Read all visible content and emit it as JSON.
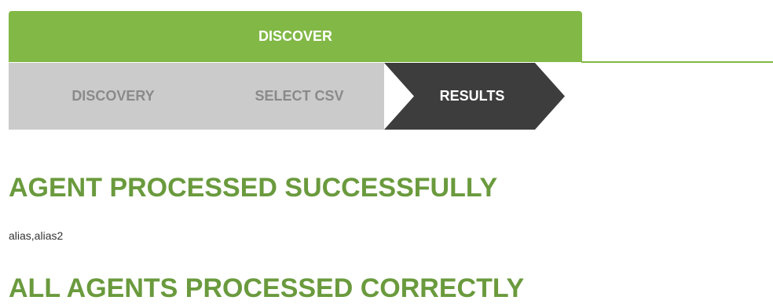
{
  "tabs": {
    "discover_label": "DISCOVER"
  },
  "wizard": {
    "steps": [
      {
        "label": "DISCOVERY",
        "state": "done"
      },
      {
        "label": "SELECT CSV",
        "state": "done"
      },
      {
        "label": "RESULTS",
        "state": "active"
      }
    ]
  },
  "results": {
    "heading_success": "AGENT PROCESSED SUCCESSFULLY",
    "processed_agents": "alias,alias2",
    "heading_all": "ALL AGENTS PROCESSED CORRECTLY"
  },
  "colors": {
    "accent_green": "#82b846",
    "heading_green": "#6a9a3d",
    "step_inactive_bg": "#cbcbcb",
    "step_active_bg": "#3d3d3d"
  }
}
